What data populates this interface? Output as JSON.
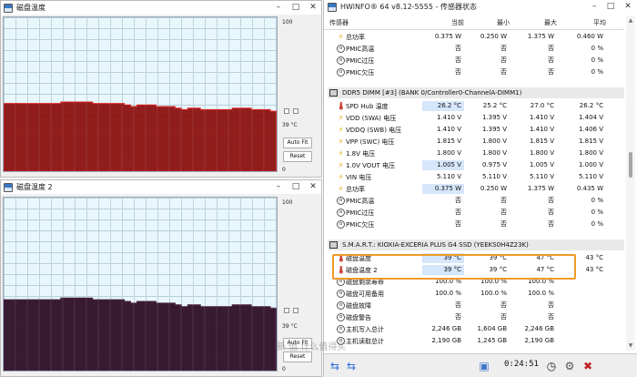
{
  "graph_windows": [
    {
      "title": "磁盘温度",
      "scale_max": "100",
      "scale_min": "0",
      "current": "39 °C",
      "autofit_label": "Auto Fit",
      "reset_label": "Reset",
      "fill_color": "#8a0b0b",
      "line_color": "#e01010"
    },
    {
      "title": "磁盘温度 2",
      "scale_max": "100",
      "scale_min": "0",
      "current": "39 °C",
      "autofit_label": "Auto Fit",
      "reset_label": "Reset",
      "fill_color": "#2a0820",
      "line_color": "#3a1030"
    }
  ],
  "hwinfo": {
    "title": "HWiNFO® 64 v8.12-5555 - 传感器状态",
    "columns": {
      "sensor": "传感器",
      "current": "当前",
      "min": "最小",
      "max": "最大",
      "avg": "平均"
    },
    "groups": [
      {
        "name": null,
        "rows": [
          {
            "icon": "bolt",
            "label": "总功率",
            "current": "0.375 W",
            "min": "0.250 W",
            "max": "1.375 W",
            "avg": "0.460 W"
          },
          {
            "icon": "ring",
            "label": "PMIC高温",
            "current": "否",
            "min": "否",
            "max": "否",
            "avg": "0 %"
          },
          {
            "icon": "ring",
            "label": "PMIC过压",
            "current": "否",
            "min": "否",
            "max": "否",
            "avg": "0 %"
          },
          {
            "icon": "ring",
            "label": "PMIC欠压",
            "current": "否",
            "min": "否",
            "max": "否",
            "avg": "0 %"
          }
        ]
      },
      {
        "name": "DDR5 DIMM [#3] (BANK 0/Controller0-ChannelA-DIMM1)",
        "rows": [
          {
            "icon": "therm",
            "label": "SPD Hub 温度",
            "current": "26.2 °C",
            "min": "25.2 °C",
            "max": "27.0 °C",
            "avg": "26.2 °C"
          },
          {
            "icon": "bolt",
            "label": "VDD (SWA) 电压",
            "current": "1.410 V",
            "min": "1.395 V",
            "max": "1.410 V",
            "avg": "1.404 V"
          },
          {
            "icon": "bolt",
            "label": "VDDQ (SWB) 电压",
            "current": "1.410 V",
            "min": "1.395 V",
            "max": "1.410 V",
            "avg": "1.406 V"
          },
          {
            "icon": "bolt",
            "label": "VPP (SWC) 电压",
            "current": "1.815 V",
            "min": "1.800 V",
            "max": "1.815 V",
            "avg": "1.815 V"
          },
          {
            "icon": "bolt",
            "label": "1.8V 电压",
            "current": "1.800 V",
            "min": "1.800 V",
            "max": "1.800 V",
            "avg": "1.800 V"
          },
          {
            "icon": "bolt",
            "label": "1.0V VOUT 电压",
            "current": "1.005 V",
            "min": "0.975 V",
            "max": "1.005 V",
            "avg": "1.000 V"
          },
          {
            "icon": "bolt",
            "label": "VIN 电压",
            "current": "5.110 V",
            "min": "5.110 V",
            "max": "5.110 V",
            "avg": "5.110 V"
          },
          {
            "icon": "bolt",
            "label": "总功率",
            "current": "0.375 W",
            "min": "0.250 W",
            "max": "1.375 W",
            "avg": "0.435 W"
          },
          {
            "icon": "ring",
            "label": "PMIC高温",
            "current": "否",
            "min": "否",
            "max": "否",
            "avg": "0 %"
          },
          {
            "icon": "ring",
            "label": "PMIC过压",
            "current": "否",
            "min": "否",
            "max": "否",
            "avg": "0 %"
          },
          {
            "icon": "ring",
            "label": "PMIC欠压",
            "current": "否",
            "min": "否",
            "max": "否",
            "avg": "0 %"
          }
        ]
      },
      {
        "name": "S.M.A.R.T.: KIOXIA-EXCERIA PLUS G4 SSD (YEEKS0H4Z23K)",
        "rows": [
          {
            "icon": "therm",
            "label": "磁盘温度",
            "current": "39 °C",
            "min": "39 °C",
            "max": "47 °C",
            "avg": "43 °C"
          },
          {
            "icon": "therm",
            "label": "磁盘温度 2",
            "current": "39 °C",
            "min": "39 °C",
            "max": "47 °C",
            "avg": "43 °C"
          },
          {
            "icon": "ring",
            "label": "磁盘剩余寿命",
            "current": "100.0 %",
            "min": "100.0 %",
            "max": "100.0 %",
            "avg": ""
          },
          {
            "icon": "ring",
            "label": "磁盘可用备用",
            "current": "100.0 %",
            "min": "100.0 %",
            "max": "100.0 %",
            "avg": ""
          },
          {
            "icon": "ring",
            "label": "磁盘故障",
            "current": "否",
            "min": "否",
            "max": "否",
            "avg": ""
          },
          {
            "icon": "ring",
            "label": "磁盘警告",
            "current": "否",
            "min": "否",
            "max": "否",
            "avg": ""
          },
          {
            "icon": "ring",
            "label": "主机写入总计",
            "current": "2,246 GB",
            "min": "1,604 GB",
            "max": "2,246 GB",
            "avg": ""
          },
          {
            "icon": "ring",
            "label": "主机读取总计",
            "current": "2,190 GB",
            "min": "1,245 GB",
            "max": "2,190 GB",
            "avg": ""
          }
        ]
      }
    ],
    "timer": "0:24:51"
  },
  "watermark": "新 值 什么值得买",
  "colors": {
    "highlight_box": "#f09a2a",
    "current_highlight": "#d6e6fb"
  }
}
